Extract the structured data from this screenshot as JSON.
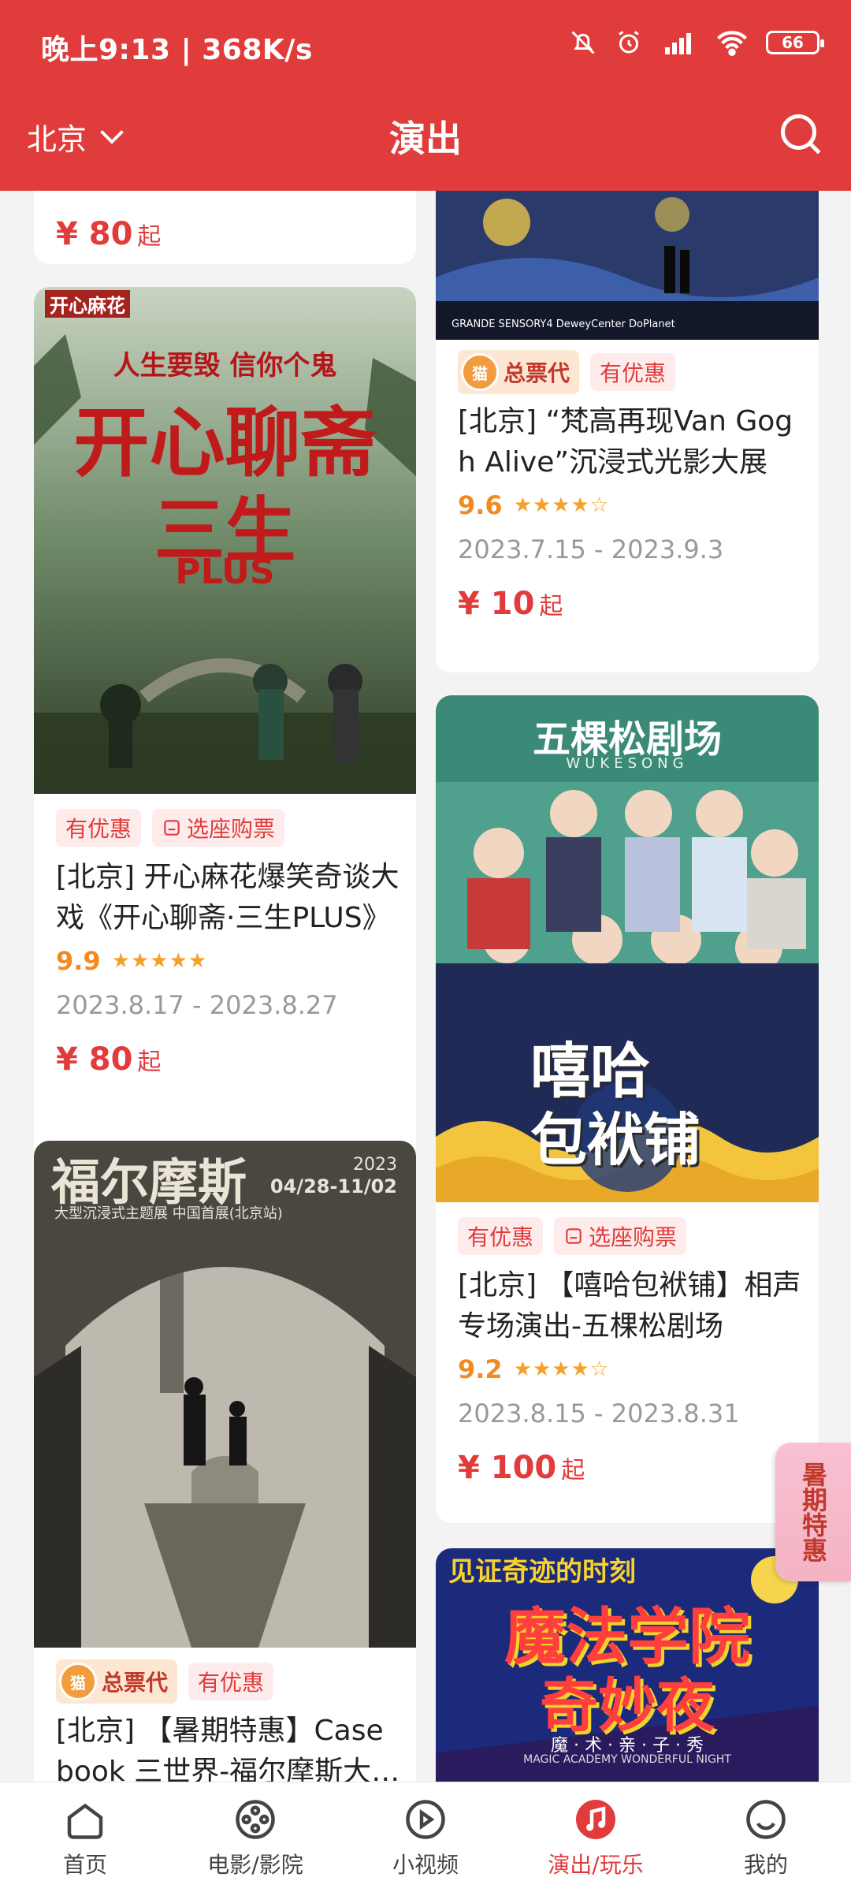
{
  "status_bar": {
    "time": "晚上9:13 | 368K/s",
    "battery": "66"
  },
  "header": {
    "city": "北京",
    "title": "演出"
  },
  "cards": [
    {
      "price": "¥ 80",
      "price_suffix": "起"
    },
    {
      "tags": [
        "有优惠",
        "选座购票"
      ],
      "title": "[北京] 开心麻花爆笑奇谈大戏《开心聊斋·三生PLUS》",
      "score": "9.9",
      "date": "2023.8.17 - 2023.8.27",
      "price": "¥ 80",
      "price_suffix": "起",
      "poster_text": {
        "brand": "开心麻花",
        "slogan": "人生要毁 信你个鬼",
        "line1": "开心聊斋",
        "line2": "三生",
        "plus": "PLUS"
      }
    },
    {
      "tags": [
        "总票代",
        "有优惠"
      ],
      "title": "[北京] 【暑期特惠】Case book 三世界-福尔摩斯大型沉浸式主题展",
      "poster_text": {
        "headline": "福尔摩斯",
        "year": "2023",
        "dates": "04/28-11/02",
        "sub": "大型沉浸式主题展 中国首展(北京站)"
      }
    },
    {
      "tags": [
        "总票代",
        "有优惠"
      ],
      "title": "[北京] “梵高再现Van Gogh Alive”沉浸式光影大展",
      "score": "9.6",
      "date": "2023.7.15 - 2023.9.3",
      "price": "¥ 10",
      "price_suffix": "起",
      "poster_text": {
        "sponsors": "GRANDE   SENSORY4   DeweyCenter   DoPlanet"
      }
    },
    {
      "tags": [
        "有优惠",
        "选座购票"
      ],
      "title": "[北京] 【嘻哈包袱铺】相声专场演出-五棵松剧场",
      "score": "9.2",
      "date": "2023.8.15 - 2023.8.31",
      "price": "¥ 100",
      "price_suffix": "起",
      "poster_text": {
        "venue": "五棵松剧场",
        "venue_en": "WUKESONG",
        "name_line1": "嘻哈",
        "name_line2": "包袱铺"
      }
    },
    {
      "poster_text": {
        "top": "见证奇迹的时刻",
        "line1": "魔法学院",
        "line2": "奇妙夜",
        "sub": "魔 · 术 · 亲 · 子 · 秀",
        "en": "MAGIC ACADEMY WONDERFUL NIGHT"
      }
    }
  ],
  "float_promo": "暑期特惠",
  "tabbar": [
    "首页",
    "电影/影院",
    "小视频",
    "演出/玩乐",
    "我的"
  ],
  "colors": {
    "brand_red": "#e13c3c",
    "price_red": "#e23b3b",
    "score_orange": "#f28a20"
  }
}
